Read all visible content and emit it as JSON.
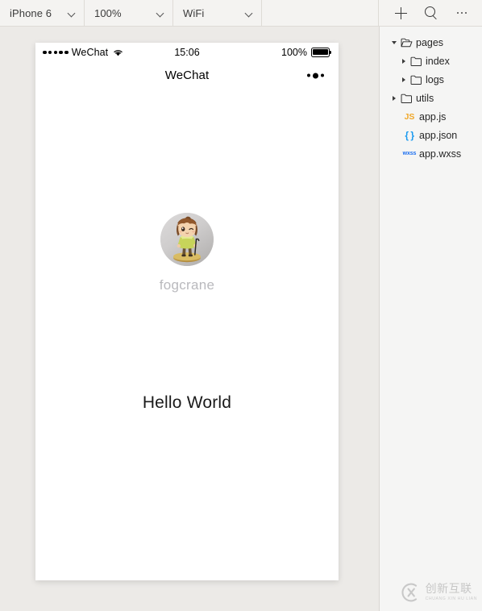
{
  "toolbar": {
    "device_select": {
      "value": "iPhone 6",
      "icon": "chevron-down-icon"
    },
    "zoom_select": {
      "value": "100%",
      "icon": "chevron-down-icon"
    },
    "network_select": {
      "value": "WiFi",
      "icon": "chevron-down-icon"
    },
    "actions": [
      {
        "name": "add-button",
        "icon": "plus-icon"
      },
      {
        "name": "search-button",
        "icon": "search-icon"
      },
      {
        "name": "more-button",
        "icon": "ellipsis-icon"
      }
    ]
  },
  "simulator": {
    "status_bar": {
      "signal_dots": 5,
      "carrier": "WeChat",
      "wifi_icon": "wifi-icon",
      "time": "15:06",
      "battery_percent": "100%",
      "battery_icon": "battery-full-icon"
    },
    "nav_bar": {
      "title": "WeChat",
      "menu_icon": "more-dots-icon"
    },
    "page": {
      "avatar_name": "user-avatar",
      "nickname": "fogcrane",
      "hello_text": "Hello World"
    }
  },
  "file_tree": {
    "items": [
      {
        "label": "pages",
        "type": "folder",
        "state": "expanded",
        "depth": 0,
        "icon": "folder-open-icon"
      },
      {
        "label": "index",
        "type": "folder",
        "state": "collapsed",
        "depth": 1,
        "icon": "folder-icon"
      },
      {
        "label": "logs",
        "type": "folder",
        "state": "collapsed",
        "depth": 1,
        "icon": "folder-icon"
      },
      {
        "label": "utils",
        "type": "folder",
        "state": "collapsed",
        "depth": 0,
        "icon": "folder-icon"
      },
      {
        "label": "app.js",
        "type": "file",
        "badge": "JS",
        "depth": 0,
        "icon": "js-file-icon"
      },
      {
        "label": "app.json",
        "type": "file",
        "badge": "{ }",
        "depth": 0,
        "icon": "json-file-icon"
      },
      {
        "label": "app.wxss",
        "type": "file",
        "badge": "wxss",
        "depth": 0,
        "icon": "wxss-file-icon"
      }
    ]
  },
  "watermark": {
    "logo_icon": "cx-logo-icon",
    "chinese": "创新互联",
    "pinyin": "CHUANG XIN HU LIAN"
  },
  "colors": {
    "toolbar_bg": "#f4f3f1",
    "stage_bg": "#eceae7",
    "panel_bg": "#f5f5f4",
    "js_yellow": "#f0a82a",
    "json_blue": "#1a9af0",
    "wxss_blue": "#1a6ef0",
    "nickname_gray": "#b9b9bd"
  }
}
